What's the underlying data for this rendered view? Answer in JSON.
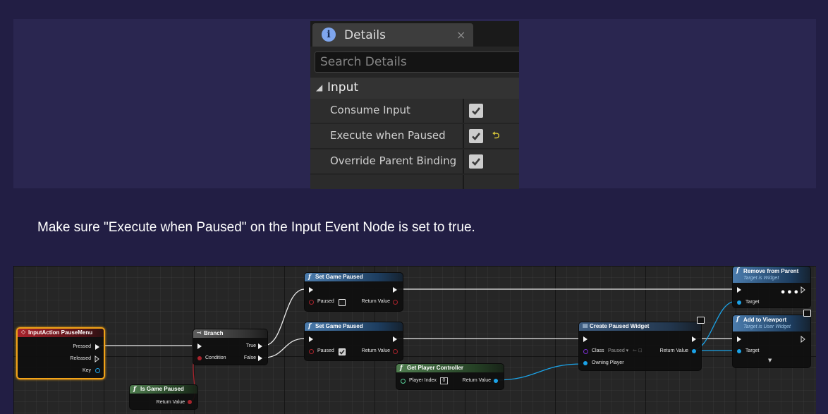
{
  "details_panel": {
    "tab_icon": "info-icon",
    "tab_icon_glyph": "i",
    "tab_title": "Details",
    "tab_close": "×",
    "search_placeholder": "Search Details",
    "category_arrow": "◢",
    "category": "Input",
    "properties": [
      {
        "label": "Consume Input",
        "checked": true,
        "reset_to_default": false
      },
      {
        "label": "Execute when Paused",
        "checked": true,
        "reset_to_default": true
      },
      {
        "label": "Override Parent Binding",
        "checked": true,
        "reset_to_default": false
      }
    ],
    "reset_glyph": "⮌"
  },
  "caption": "Make sure \"Execute when Paused\" on the Input Event Node is set to true.",
  "blueprint": {
    "input_action": {
      "title": "InputAction PauseMenu",
      "pins": [
        "Pressed",
        "Released",
        "Key"
      ]
    },
    "is_game_paused": {
      "title": "Is Game Paused",
      "return_value": "Return Value"
    },
    "branch": {
      "title": "Branch",
      "condition": "Condition",
      "true": "True",
      "false": "False"
    },
    "set_game_paused_1": {
      "title": "Set Game Paused",
      "paused": "Paused",
      "paused_checked": false,
      "return_value": "Return Value"
    },
    "set_game_paused_2": {
      "title": "Set Game Paused",
      "paused": "Paused",
      "paused_checked": true,
      "return_value": "Return Value"
    },
    "get_player_controller": {
      "title": "Get Player Controller",
      "player_index_label": "Player Index",
      "player_index": "0",
      "return_value": "Return Value"
    },
    "create_widget": {
      "title": "Create Paused Widget",
      "class_label": "Class",
      "class_value": "Paused ▾",
      "return_value": "Return Value",
      "owning_player": "Owning Player"
    },
    "remove_from_parent": {
      "title": "Remove from Parent",
      "subtitle": "Target is Widget",
      "target": "Target"
    },
    "add_to_viewport": {
      "title": "Add to Viewport",
      "subtitle": "Target is User Widget",
      "target": "Target"
    },
    "function_glyph": "f",
    "more_glyph": "•••",
    "expand_glyph": "▼",
    "colors": {
      "exec": "#f2f2f2",
      "bool": "#a8232c",
      "object": "#1ba3e8",
      "struct": "#58d098",
      "class": "#7b2fd2",
      "selected": "#f2a318"
    }
  }
}
